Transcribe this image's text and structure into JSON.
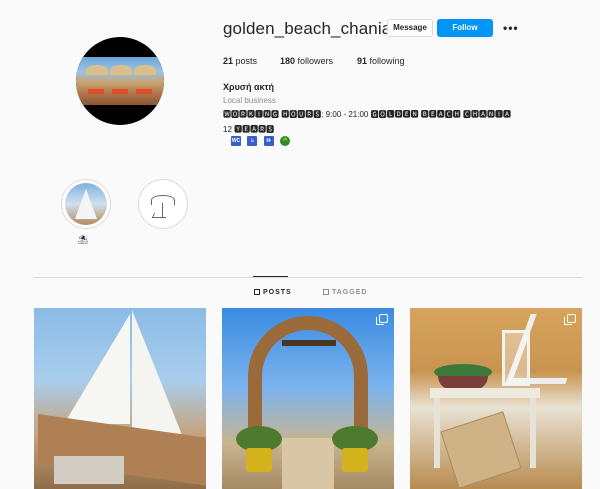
{
  "profile": {
    "username": "golden_beach_chania",
    "message_label": "Message",
    "follow_label": "Follow",
    "more_label": "•••",
    "posts_count": "21",
    "posts_label": " posts",
    "followers_count": "180",
    "followers_label": " followers",
    "following_count": "91",
    "following_label": " following",
    "full_name": "Χρυσή ακτή",
    "category": "Local business",
    "bio_line1": "🆆🅾🆁🅺🅸🅽🅶 🅷🅾🆄🆁🆂: 9:00 - 21:00 🅶🅾🅻🅳🅴🅽 🅱🅴🅰🅲🅷 🅲🅷🅰🅽🅸🅰",
    "bio_line2": "12 🆈🅴🅰🆁🆂",
    "bio_emojis": [
      "WC",
      "♿",
      "🚻",
      "🌳"
    ]
  },
  "highlights": [
    {
      "name": "sailboat-highlight",
      "label": "⛱"
    },
    {
      "name": "beach-sketch-highlight",
      "label": ""
    }
  ],
  "tabs": {
    "posts_label": "POSTS",
    "tagged_label": "TAGGED"
  },
  "posts": [
    {
      "name": "post-sailboat",
      "multi": false
    },
    {
      "name": "post-heart-arch",
      "multi": true
    },
    {
      "name": "post-table-lantern",
      "multi": true
    }
  ],
  "colors": {
    "follow_button": "#0095f6",
    "divider": "#dbdbdb",
    "muted_text": "#8e8e8e"
  }
}
